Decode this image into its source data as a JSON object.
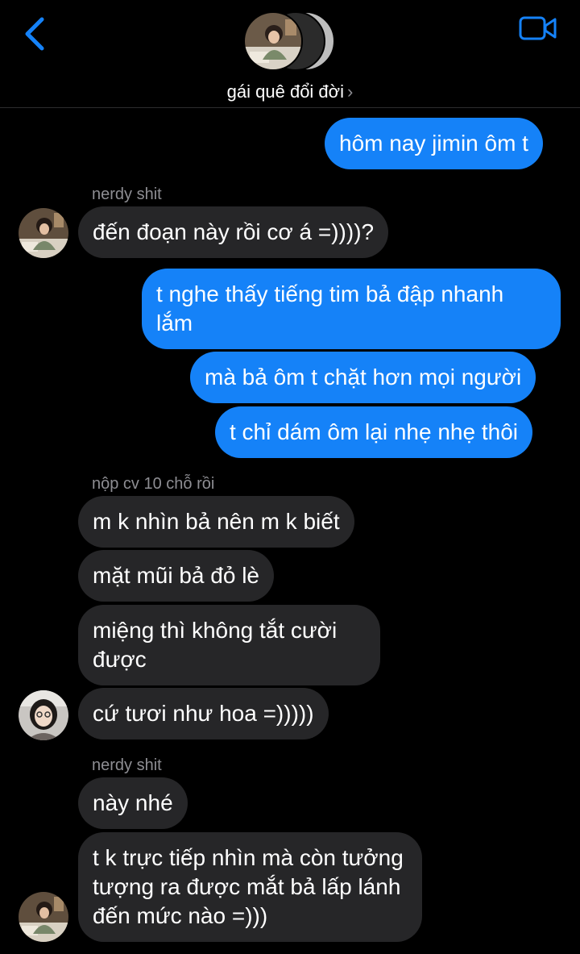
{
  "header": {
    "title": "gái quê đổi đời",
    "title_chevron": "›",
    "back_icon": "chevron-left-icon",
    "video_icon": "video-camera-icon",
    "accent": "#1582F8"
  },
  "messages": [
    {
      "type": "sent",
      "text": "hôm nay jimin ôm t"
    },
    {
      "type": "sender",
      "text": "nerdy shit"
    },
    {
      "type": "recv",
      "text": "đến đoạn này rồi cơ á =))))?"
    },
    {
      "type": "sent",
      "text": "t nghe thấy tiếng tim bả đập nhanh lắm"
    },
    {
      "type": "sent",
      "text": "mà bả ôm t chặt hơn mọi người"
    },
    {
      "type": "sent",
      "text": "t chỉ dám ôm lại nhẹ nhẹ thôi"
    },
    {
      "type": "sender",
      "text": "nộp cv 10 chỗ rồi"
    },
    {
      "type": "recv",
      "text": "m k nhìn bả nên m k biết"
    },
    {
      "type": "recv",
      "text": "mặt mũi bả đỏ lè"
    },
    {
      "type": "recv",
      "text": "miệng thì không tắt cười được"
    },
    {
      "type": "recv",
      "text": "cứ tươi như hoa =)))))"
    },
    {
      "type": "sender",
      "text": "nerdy shit"
    },
    {
      "type": "recv",
      "text": "này nhé"
    },
    {
      "type": "recv",
      "text": "t k trực tiếp nhìn mà còn tưởng tượng ra được mắt bả lấp lánh đến mức nào =)))"
    }
  ],
  "colors": {
    "sent_bubble": "#1582F8",
    "recv_bubble": "#262628",
    "sender_name": "#8E8E93",
    "background": "#000000"
  }
}
